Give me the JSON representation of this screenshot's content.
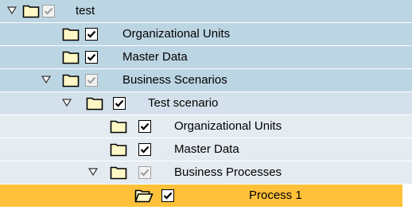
{
  "colors": {
    "row_level_0": "#bcd5e3",
    "row_level_2": "#d4e1ec",
    "row_level_3": "#e4ebf1",
    "selected": "#ffc13a",
    "checkbox_disabled": "#a0a0a0"
  },
  "tree": {
    "nodes": [
      {
        "label": "test",
        "expanded": true,
        "checked": true,
        "check_disabled": true,
        "folder": "closed"
      },
      {
        "label": "Organizational Units",
        "checked": true,
        "check_disabled": false,
        "folder": "closed"
      },
      {
        "label": "Master Data",
        "checked": true,
        "check_disabled": false,
        "folder": "closed"
      },
      {
        "label": "Business Scenarios",
        "expanded": true,
        "checked": true,
        "check_disabled": true,
        "folder": "closed"
      },
      {
        "label": "Test scenario",
        "expanded": true,
        "checked": true,
        "check_disabled": false,
        "folder": "closed"
      },
      {
        "label": "Organizational Units",
        "checked": true,
        "check_disabled": false,
        "folder": "closed"
      },
      {
        "label": "Master Data",
        "checked": true,
        "check_disabled": false,
        "folder": "closed"
      },
      {
        "label": "Business Processes",
        "expanded": true,
        "checked": true,
        "check_disabled": true,
        "folder": "closed"
      },
      {
        "label": "Process 1",
        "checked": true,
        "check_disabled": false,
        "folder": "open",
        "selected": true
      }
    ]
  }
}
